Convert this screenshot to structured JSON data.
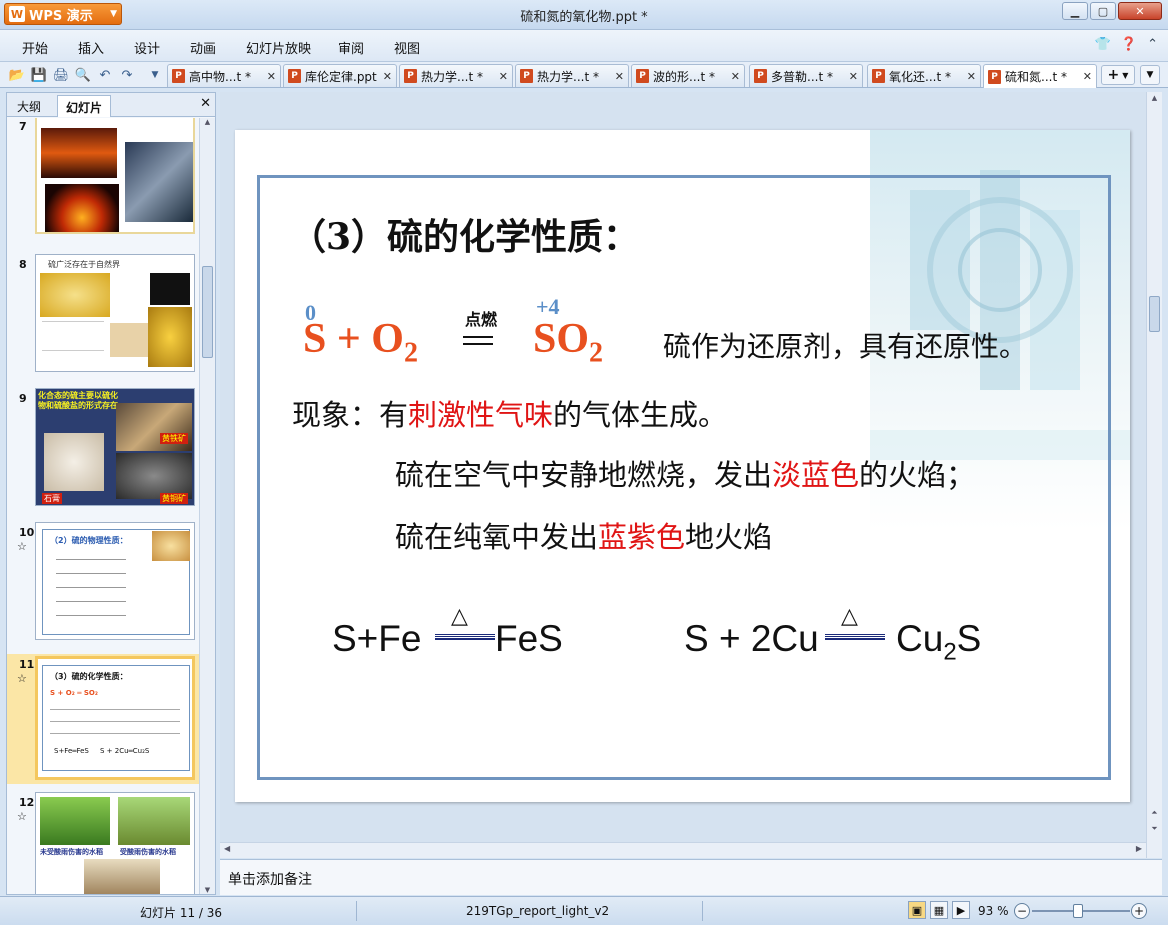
{
  "app": {
    "brand": "WPS 演示",
    "logo_letter": "W",
    "window_title": "硫和氮的氧化物.ppt *"
  },
  "menu": [
    "开始",
    "插入",
    "设计",
    "动画",
    "幻灯片放映",
    "审阅",
    "视图"
  ],
  "tabs": [
    {
      "name": "高中物...t *"
    },
    {
      "name": "库伦定律.ppt"
    },
    {
      "name": "热力学...t *"
    },
    {
      "name": "热力学...t *"
    },
    {
      "name": "波的形...t *"
    },
    {
      "name": "多普勒...t *"
    },
    {
      "name": "氧化还...t *"
    },
    {
      "name": "硫和氮...t *"
    }
  ],
  "left_panel": {
    "tab_outline": "大纲",
    "tab_slides": "幻灯片",
    "thumbnails": [
      {
        "num": "7",
        "star": ""
      },
      {
        "num": "8",
        "star": "",
        "title": "硫广泛存在于自然界"
      },
      {
        "num": "9",
        "star": "",
        "title": "化合态的硫主要以硫化物和硫酸盐的形式存在",
        "label_a": "石膏",
        "label_b": "黄铁矿",
        "label_c": "黄铜矿"
      },
      {
        "num": "10",
        "star": "☆",
        "title": "（2）硫的物理性质："
      },
      {
        "num": "11",
        "star": "☆",
        "title": "（3）硫的化学性质："
      },
      {
        "num": "12",
        "star": "☆",
        "label_a": "未受酸雨伤害的水稻",
        "label_b": "受酸雨伤害的水稻"
      }
    ]
  },
  "slide": {
    "title": "（3）硫的化学性质：",
    "ox_s": "0",
    "ox_so2": "+4",
    "eq_left": "S + O",
    "eq_left_sub": "2",
    "condition": "点燃",
    "eq_product": "SO",
    "eq_product_sub": "2",
    "eq_note": "硫作为还原剂，具有还原性。",
    "line1_a": "现象：有",
    "line1_red": "刺激性气味",
    "line1_b": "的气体生成。",
    "line2_a": "硫在空气中安静地燃烧，发出",
    "line2_red": "淡蓝色",
    "line2_b": "的火焰；",
    "line3_a": "硫在纯氧中发出",
    "line3_red": "蓝紫色",
    "line3_b": "地火焰",
    "rxn1_left": "S+Fe",
    "rxn1_right": "FeS",
    "rxn2_left": "S + 2Cu",
    "rxn2_right_a": "Cu",
    "rxn2_right_sub": "2",
    "rxn2_right_b": "S",
    "delta": "△"
  },
  "notes_placeholder": "单击添加备注",
  "status": {
    "slide_counter": "幻灯片 11 / 36",
    "template_name": "219TGp_report_light_v2",
    "zoom": "93 %"
  },
  "colors": {
    "accent_orange": "#e46d10",
    "equation_red": "#e8501f",
    "highlight_red": "#e01515",
    "frame_blue": "#6f94bf"
  }
}
